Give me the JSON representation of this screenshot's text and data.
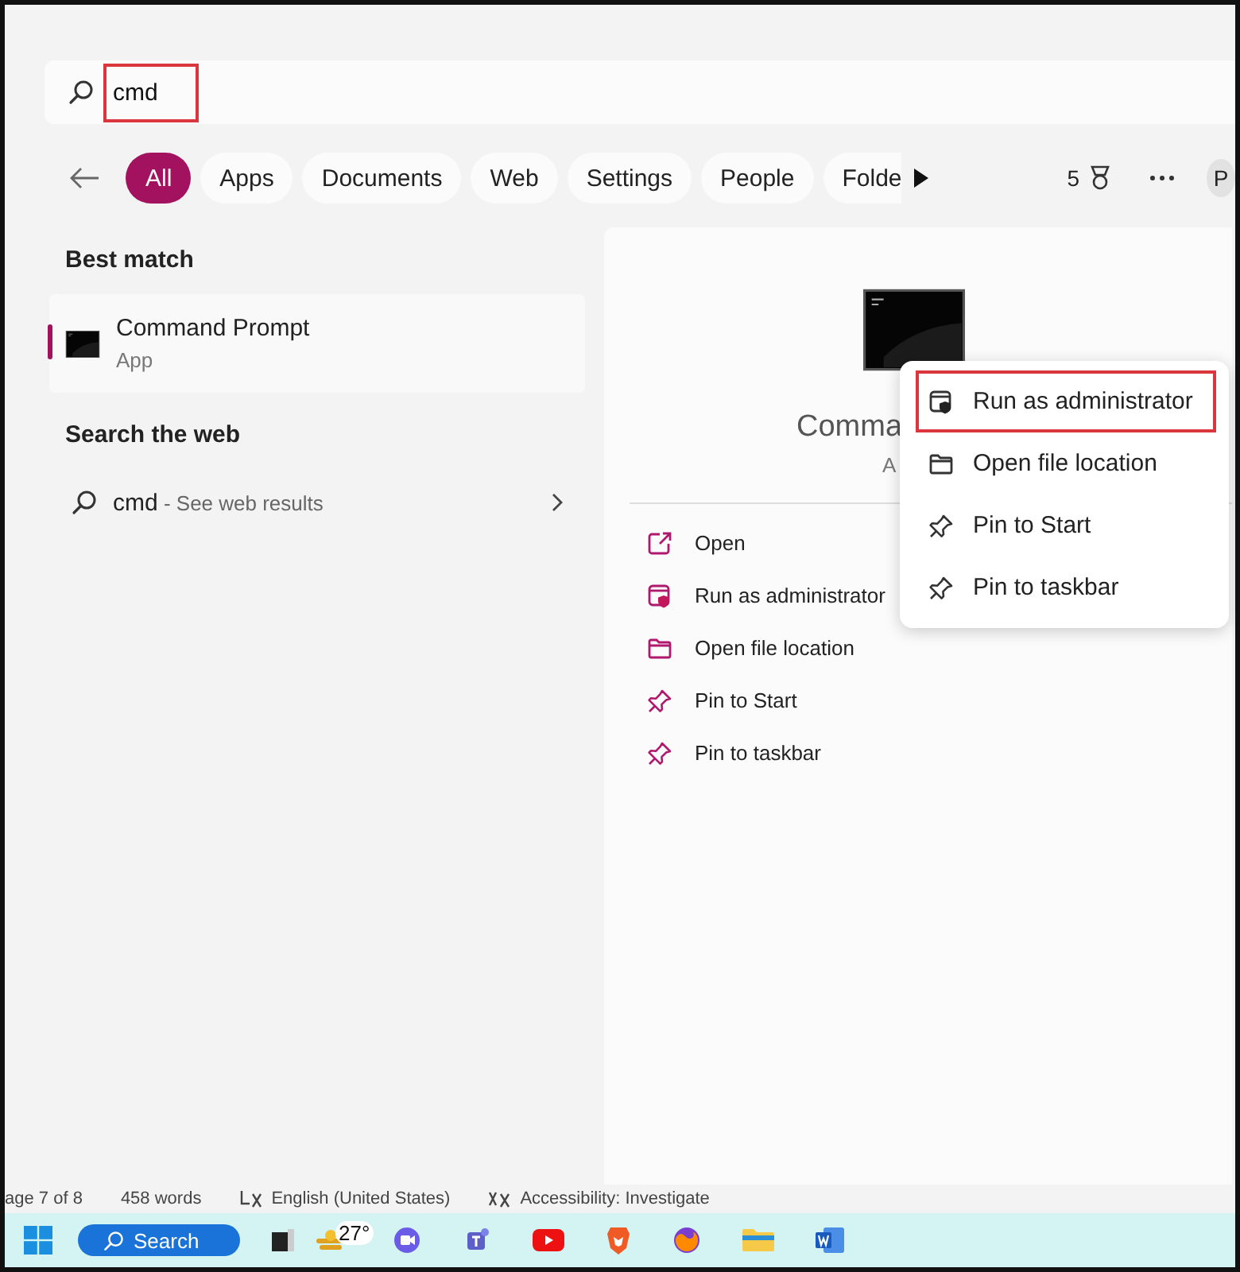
{
  "search": {
    "value": "cmd",
    "highlighted": true
  },
  "filters": [
    {
      "label": "All",
      "selected": true
    },
    {
      "label": "Apps",
      "selected": false
    },
    {
      "label": "Documents",
      "selected": false
    },
    {
      "label": "Web",
      "selected": false
    },
    {
      "label": "Settings",
      "selected": false
    },
    {
      "label": "People",
      "selected": false
    },
    {
      "label": "Folde",
      "selected": false
    }
  ],
  "rewards_points": "5",
  "avatar_initial": "P",
  "best_match": {
    "heading": "Best match",
    "title": "Command Prompt",
    "subtitle": "App",
    "selected": true
  },
  "web_search": {
    "heading": "Search the web",
    "query": "cmd",
    "suffix": " - See web results"
  },
  "details": {
    "title": "Comma",
    "subtitle": "A",
    "actions": [
      {
        "kind": "open",
        "label": "Open"
      },
      {
        "kind": "admin",
        "label": "Run as administrator"
      },
      {
        "kind": "folder",
        "label": "Open file location"
      },
      {
        "kind": "pin",
        "label": "Pin to Start"
      },
      {
        "kind": "pin",
        "label": "Pin to taskbar"
      }
    ]
  },
  "context_menu": [
    {
      "kind": "admin",
      "label": "Run as administrator",
      "highlighted": true
    },
    {
      "kind": "folder",
      "label": "Open file location",
      "highlighted": false
    },
    {
      "kind": "pin",
      "label": "Pin to Start",
      "highlighted": false
    },
    {
      "kind": "pin",
      "label": "Pin to taskbar",
      "highlighted": false
    }
  ],
  "status_bar": {
    "page": "age 7 of 8",
    "words": "458 words",
    "language": "English (United States)",
    "accessibility": "Accessibility: Investigate"
  },
  "taskbar": {
    "search_label": "Search",
    "temperature": "27°"
  }
}
